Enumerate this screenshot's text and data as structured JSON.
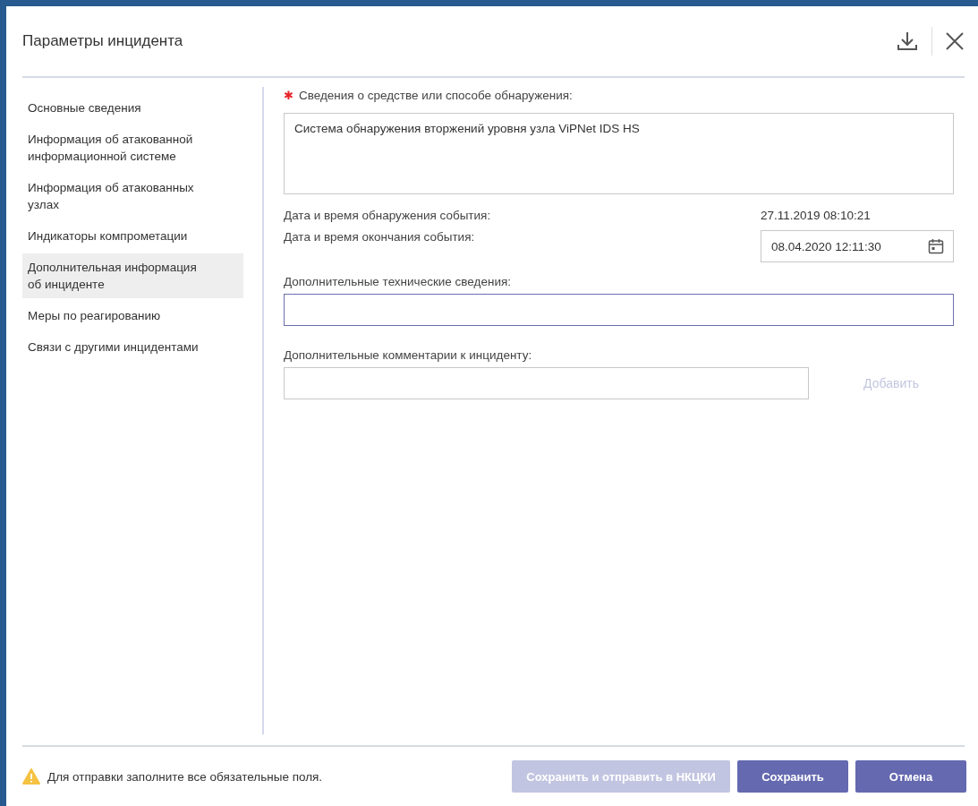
{
  "dialog": {
    "title": "Параметры инцидента"
  },
  "sidebar": {
    "items": [
      {
        "label": "Основные сведения",
        "selected": false
      },
      {
        "label": "Информация об атакованной информационной системе",
        "selected": false
      },
      {
        "label": "Информация об атакованных узлах",
        "selected": false
      },
      {
        "label": "Индикаторы компрометации",
        "selected": false
      },
      {
        "label": "Дополнительная информация об инциденте",
        "selected": true
      },
      {
        "label": "Меры по реагированию",
        "selected": false
      },
      {
        "label": "Связи с другими инцидентами",
        "selected": false
      }
    ]
  },
  "form": {
    "detection": {
      "required_mark": "✱",
      "label": "Сведения о средстве или способе обнаружения:",
      "value": "Система обнаружения вторжений уровня узла ViPNet IDS HS"
    },
    "detected_at": {
      "label": "Дата и время обнаружения события:",
      "value": "27.11.2019 08:10:21"
    },
    "ended_at": {
      "label": "Дата и время окончания события:",
      "value": "08.04.2020 12:11:30"
    },
    "technical": {
      "label": "Дополнительные технические сведения:",
      "focused": true
    },
    "comments": {
      "label": "Дополнительные комментарии к инциденту:",
      "add_button": {
        "label": "Добавить",
        "disabled": true
      }
    }
  },
  "footer": {
    "warning": "Для отправки заполните все обязательные поля.",
    "buttons": [
      {
        "label": "Сохранить и отправить в НКЦКИ",
        "disabled": true
      },
      {
        "label": "Сохранить",
        "disabled": false
      },
      {
        "label": "Отмена",
        "disabled": false
      }
    ]
  }
}
